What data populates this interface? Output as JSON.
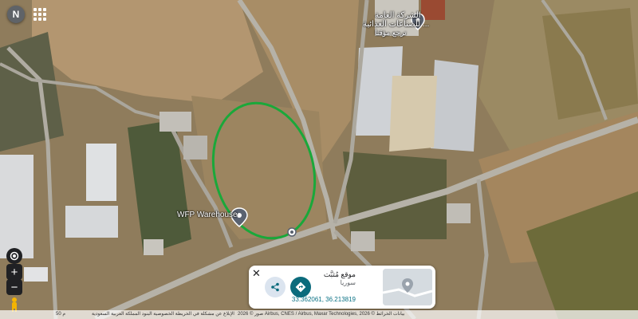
{
  "account": {
    "initial": "N"
  },
  "labels": {
    "company_line1": "الشركة العامة",
    "company_line2": "للصناعات الغذائية ...",
    "company_line3": "ترجع مؤقتا",
    "warehouse": "WFP Warehouse"
  },
  "controls": {
    "locate_icon": "locate-icon",
    "zoom_in": "+",
    "zoom_out": "−",
    "pegman_icon": "pegman-icon"
  },
  "card": {
    "close": "✕",
    "place": "موقع مُثبَّت",
    "region": "سوريا",
    "coords": "33.362061, 36.213819"
  },
  "attribution": {
    "scale": "50 م",
    "links": "الإبلاغ عن مشكلة في الخريطة   الخصوصية   البنود   المملكة العربية السعودية",
    "imagery": "صور © 2026 Airbus, CNES / Airbus, Maxar Technologies, بيانات الخرائط © 2026"
  },
  "colors": {
    "highlight": "#1aa83a",
    "pin": "#5a6270",
    "direction": "#0b6b7c"
  }
}
